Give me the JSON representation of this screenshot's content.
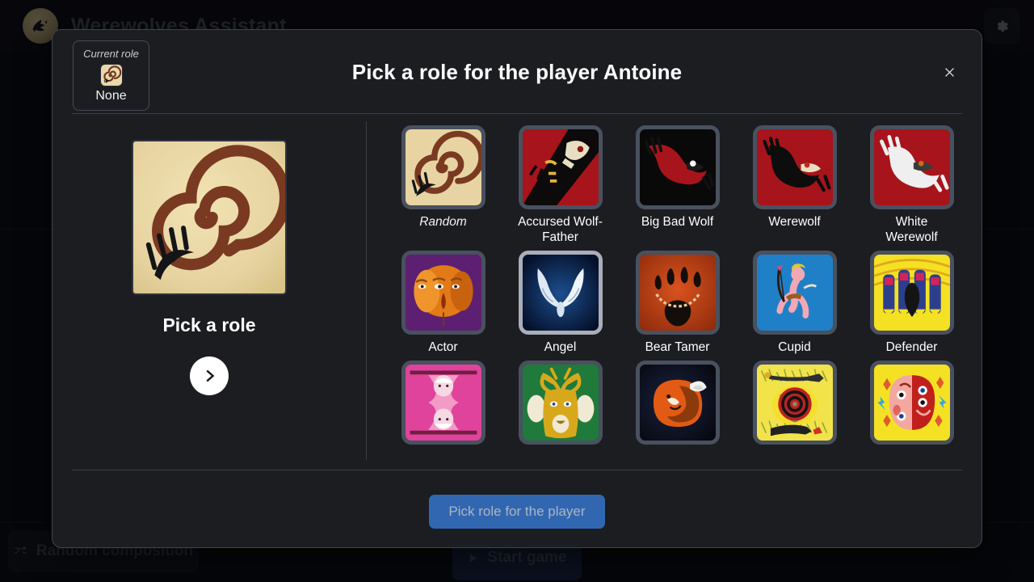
{
  "background": {
    "app_title": "Werewolves Assistant",
    "logo_icon": "wolf-howling-icon",
    "settings_icon": "gear-icon",
    "random_composition_label": "Random composition",
    "random_composition_icon": "shuffle-icon",
    "start_game_label": "Start game",
    "start_game_icon": "play-icon"
  },
  "dialog": {
    "title": "Pick a role for the player Antoine",
    "close_icon": "close-icon",
    "current_role": {
      "label": "Current role",
      "value": "None",
      "thumb": "spiral-random-icon"
    },
    "preview": {
      "name": "Pick a role",
      "image": "spiral-random-art",
      "next_icon": "chevron-right-icon"
    },
    "footer": {
      "submit_label": "Pick role for the player",
      "submit_color": "#3167b0"
    }
  },
  "roles": [
    {
      "label": "Random",
      "art": "random",
      "italic": true,
      "selected": false
    },
    {
      "label": "Accursed Wolf-Father",
      "art": "accursed",
      "italic": false,
      "selected": false
    },
    {
      "label": "Big Bad Wolf",
      "art": "bigbadwolf",
      "italic": false,
      "selected": false
    },
    {
      "label": "Werewolf",
      "art": "werewolf",
      "italic": false,
      "selected": false
    },
    {
      "label": "White Werewolf",
      "art": "whitewolf",
      "italic": false,
      "selected": false
    },
    {
      "label": "Actor",
      "art": "actor",
      "italic": false,
      "selected": false
    },
    {
      "label": "Angel",
      "art": "angel",
      "italic": false,
      "selected": true
    },
    {
      "label": "Bear Tamer",
      "art": "beartamer",
      "italic": false,
      "selected": false
    },
    {
      "label": "Cupid",
      "art": "cupid",
      "italic": false,
      "selected": false
    },
    {
      "label": "Defender",
      "art": "defender",
      "italic": false,
      "selected": false
    },
    {
      "label": "",
      "art": "pinkrole",
      "italic": false,
      "selected": false
    },
    {
      "label": "",
      "art": "treerole",
      "italic": false,
      "selected": false
    },
    {
      "label": "",
      "art": "foxrole",
      "italic": false,
      "selected": false
    },
    {
      "label": "",
      "art": "gunrole",
      "italic": false,
      "selected": false
    },
    {
      "label": "",
      "art": "maskrole",
      "italic": false,
      "selected": false
    }
  ]
}
